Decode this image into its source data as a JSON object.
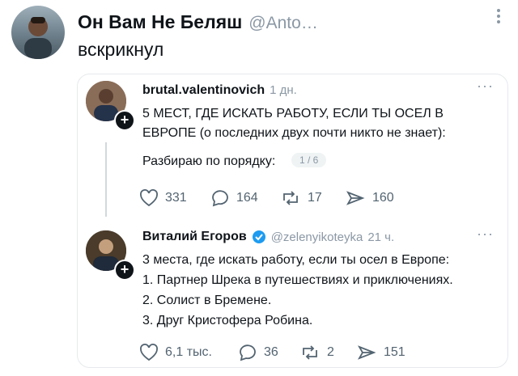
{
  "main_post": {
    "author_name": "Он Вам Не Беляш",
    "author_handle": "@Anto…",
    "text": "вскрикнул"
  },
  "quoted_thread": {
    "post1": {
      "author": "brutal.valentinovich",
      "time": "1 дн.",
      "text_line1": "5 МЕСТ, ГДЕ ИСКАТЬ РАБОТУ, ЕСЛИ ТЫ ОСЕЛ В",
      "text_line2": "ЕВРОПЕ (о последних двух почти никто не знает):",
      "text_line3": "Разбираю по порядку:",
      "pager": "1 / 6",
      "stats": {
        "replies": "331",
        "reposts": "164",
        "likes_repost": "17",
        "views": "160"
      }
    },
    "post2": {
      "author": "Виталий Егоров",
      "handle": "@zelenyikoteyka",
      "time": "21 ч.",
      "lines": [
        "3 места, где искать работу, если ты осел в Европе:",
        "1. Партнер Шрека в путешествиях и приключениях.",
        "2. Солист в Бремене.",
        "3. Друг Кристофера Робина."
      ],
      "stats": {
        "likes": "6,1 тыс.",
        "replies": "36",
        "reposts": "2",
        "views": "151"
      }
    }
  },
  "colors": {
    "verified": "#1d9bf0",
    "muted": "#8b98a5",
    "border": "#e6e9ec"
  }
}
